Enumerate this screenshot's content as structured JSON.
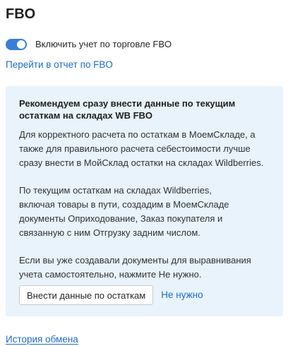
{
  "header": {
    "title": "FBO"
  },
  "settings": {
    "fbo_toggle_label": "Включить учет по торговле FBO",
    "fbo_toggle_on": true,
    "toggle_color": "#3b7fd4"
  },
  "links": {
    "report": "Перейти в отчет по FBO",
    "history": "История обмена"
  },
  "notice": {
    "heading": "Рекомендуем сразу внести данные по текущим остаткам на складах WB FBO",
    "paragraph_1": "Для корректного расчета по остаткам в МоемСкладе, а также для правильного расчета себестоимости лучше сразу внести в МойСклад остатки на складах Wildberries.",
    "paragraph_2": "По текущим остаткам на складах Wildberries, включая товары в пути, создадим в МоемСкладе документы Оприходование, Заказ покупателя и связанную с ним Отгрузку задним числом.",
    "paragraph_3": "Если вы уже создавали документы для выравнивания учета самостоятельно, нажмите Не нужно.",
    "primary_button": "Внести данные по остаткам",
    "secondary_link": "Не нужно",
    "background_color": "#e8f3fc"
  },
  "colors": {
    "link": "#1f6cbf"
  }
}
